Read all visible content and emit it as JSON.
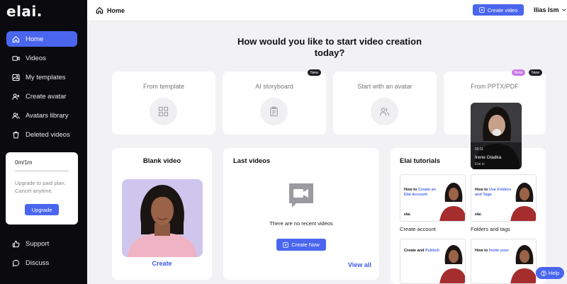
{
  "app": {
    "logo": "elai."
  },
  "sidebar": {
    "items": [
      {
        "label": "Home",
        "icon": "home-icon",
        "active": true
      },
      {
        "label": "Videos",
        "icon": "video-icon"
      },
      {
        "label": "My templates",
        "icon": "templates-icon"
      },
      {
        "label": "Create avatar",
        "icon": "add-person-icon"
      },
      {
        "label": "Avatars library",
        "icon": "people-icon"
      },
      {
        "label": "Deleted videos",
        "icon": "trash-icon"
      }
    ],
    "bottom_items": [
      {
        "label": "Support",
        "icon": "thumbs-up-icon"
      },
      {
        "label": "Discuss",
        "icon": "chat-bubble-icon"
      }
    ],
    "upgrade": {
      "usage": "0m/1m",
      "usage_fraction": 0,
      "message": "Upgrade to paid plan. Cancel anytime.",
      "button": "Upgrade"
    }
  },
  "header": {
    "breadcrumb": "Home",
    "create_button": "Create video",
    "user": "Ilias Ism"
  },
  "main": {
    "heading": "How would you like to start video creation today?",
    "options": [
      {
        "label": "From template",
        "icon": "grid-icon"
      },
      {
        "label": "AI storyboard",
        "icon": "clipboard-icon",
        "badge": "New"
      },
      {
        "label": "Start with an avatar",
        "icon": "people-icon"
      },
      {
        "label": "From PPTX/PDF",
        "badges": [
          "Beta",
          "New"
        ]
      }
    ],
    "preview": {
      "time": "00:11",
      "name": "Irene Gladka",
      "org": "Elai.io"
    },
    "blank": {
      "title": "Blank video",
      "link": "Create"
    },
    "last": {
      "title": "Last videos",
      "empty": "There are no recent videos",
      "button": "Create Now",
      "link": "View all"
    },
    "tutorials": {
      "title": "Elai tutorials",
      "items": [
        {
          "thumb_prefix": "How to ",
          "thumb_highlight": "Create an Elai Account",
          "label": "Create account"
        },
        {
          "thumb_prefix": "How to ",
          "thumb_highlight": "Use Folders and Tags",
          "label": "Folders and tags"
        },
        {
          "thumb_prefix": "Create and ",
          "thumb_highlight": "Publish",
          "label": ""
        },
        {
          "thumb_prefix": "How to ",
          "thumb_highlight": "Invite your",
          "label": ""
        }
      ],
      "thumb_logo": "elai."
    },
    "help": "Help"
  },
  "colors": {
    "accent": "#4a66ee",
    "sidebar_bg": "#0b0b0f",
    "page_bg": "#f2f2f4"
  }
}
